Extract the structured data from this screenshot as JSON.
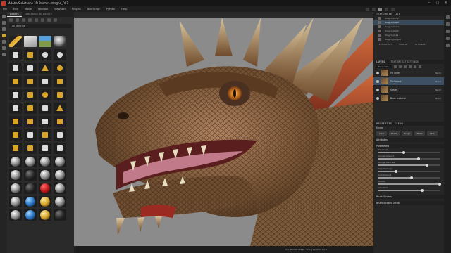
{
  "app": {
    "title": "Adobe Substance 3D Painter - dragon_002"
  },
  "menu": {
    "items": [
      "File",
      "Edit",
      "Mode",
      "Window",
      "Viewport",
      "Plugins",
      "JavaScript",
      "Python",
      "Help"
    ]
  },
  "assets": {
    "tabs": [
      "ASSETS",
      "SUBSTANCE 3D ASSETS"
    ],
    "search_value": "All libraries"
  },
  "texture_set": {
    "header": "TEXTURE SET LIST",
    "rows": [
      {
        "name": "dragon_body",
        "active": false
      },
      {
        "name": "dragon_head",
        "active": true
      },
      {
        "name": "dragon_horns",
        "active": false
      },
      {
        "name": "dragon_teeth",
        "active": false
      },
      {
        "name": "dragon_eyes",
        "active": false
      },
      {
        "name": "dragon_tongue",
        "active": false
      }
    ],
    "subtabs": [
      "TEXTURE SET",
      "DISPLAY",
      "SETTINGS"
    ]
  },
  "layers": {
    "tabs": [
      "LAYERS",
      "TEXTURE SET SETTINGS"
    ],
    "dropdown": "Base color",
    "items": [
      {
        "name": "Fill layer",
        "blend": "Norm",
        "selected": false
      },
      {
        "name": "Dirt mask",
        "blend": "Norm",
        "selected": true
      },
      {
        "name": "Scales",
        "blend": "Norm",
        "selected": false
      },
      {
        "name": "Base material",
        "blend": "Norm",
        "selected": false
      }
    ]
  },
  "parameters": {
    "header": "PROPERTIES - CLEAN",
    "brush_label": "Stroke",
    "chips": [
      "Color",
      "Height",
      "Rough",
      "Metal",
      "Nrm"
    ],
    "section_attributes": "Attributes",
    "section_parameters": "Parameters",
    "section_brush": "Brush Strokes",
    "section_grunge": "Brush Strokes Details",
    "sliders": [
      {
        "label": "Dirt Level",
        "value": 0.42
      },
      {
        "label": "Grunge Amount",
        "value": 0.66
      },
      {
        "label": "Grunge Contrast",
        "value": 0.8
      },
      {
        "label": "Edge Damage",
        "value": 0.3
      },
      {
        "label": "Dust Amount",
        "value": 0.55
      },
      {
        "label": "Opacity",
        "value": 1.0
      },
      {
        "label": "Saturation",
        "value": 0.72
      }
    ]
  },
  "status": {
    "text": "Cache Disk Usage: 52% | Version: 9.0.1"
  }
}
